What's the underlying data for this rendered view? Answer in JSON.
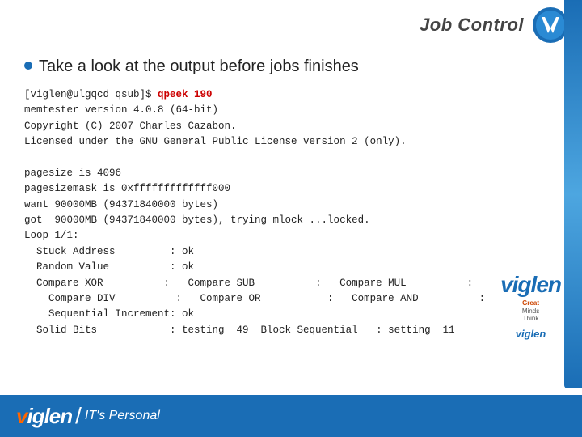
{
  "header": {
    "title": "Job Control",
    "logo_alt": "Viglen logo"
  },
  "slide": {
    "bullet": "Take a look at the output before jobs finishes",
    "terminal_lines": [
      {
        "text": "[viglen@ulgqcd qsub]$ ",
        "normal": true,
        "cmd": "qpeek 190"
      },
      {
        "text": "memtester version 4.0.8 (64-bit)",
        "normal": true
      },
      {
        "text": "Copyright (C) 2007 Charles Cazabon.",
        "normal": true
      },
      {
        "text": "Licensed under the GNU General Public License version 2 (only).",
        "normal": true
      },
      {
        "text": "",
        "normal": true
      },
      {
        "text": "pagesize is 4096",
        "normal": true
      },
      {
        "text": "pagesizemask is 0xfffffffffffff000",
        "normal": true
      },
      {
        "text": "want 90000MB (94371840000 bytes)",
        "normal": true
      },
      {
        "text": "got  90000MB (94371840000 bytes), trying mlock ...locked.",
        "normal": true
      },
      {
        "text": "Loop 1/1:",
        "normal": true
      },
      {
        "text": "  Stuck Address         : ok",
        "normal": true
      },
      {
        "text": "  Random Value          : ok",
        "normal": true
      },
      {
        "text": "  Compare XOR          :   Compare SUB          :   Compare MUL          :",
        "normal": true
      },
      {
        "text": "    Compare DIV          :   Compare OR           :   Compare AND          :",
        "normal": true
      },
      {
        "text": "    Sequential Increment: ok",
        "normal": true
      },
      {
        "text": "  Solid Bits            : testing  49  Block Sequential   : setting  11",
        "normal": true
      }
    ]
  },
  "footer": {
    "logo_v": "v",
    "logo_rest": "iglen",
    "divider": "/",
    "tagline": "IT's Personal"
  },
  "side_logo": {
    "text": "viglen",
    "great": "Great",
    "minds": "Minds",
    "think": "Think",
    "bottom": "viglen"
  }
}
